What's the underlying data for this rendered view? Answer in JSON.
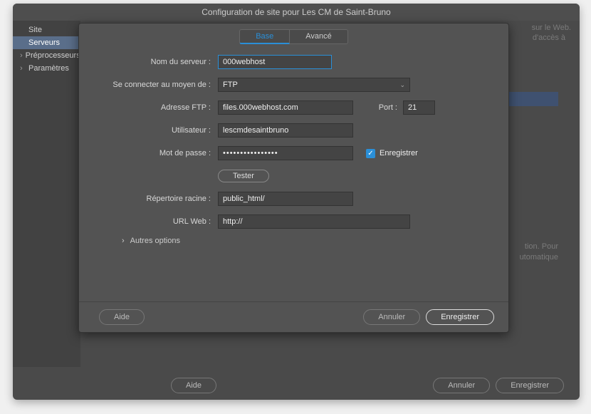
{
  "outer": {
    "title": "Configuration de site pour Les CM de Saint-Bruno",
    "sidebar": {
      "items": [
        {
          "label": "Site"
        },
        {
          "label": "Serveurs"
        },
        {
          "label": "Préprocesseurs"
        },
        {
          "label": "Paramètres"
        }
      ]
    },
    "bg_text1": "sur le Web.",
    "bg_text2": "d'accès à",
    "bg_status1": "tion. Pour",
    "bg_status2": "utomatique",
    "footer": {
      "help": "Aide",
      "cancel": "Annuler",
      "save": "Enregistrer"
    }
  },
  "inner": {
    "tabs": {
      "base": "Base",
      "advanced": "Avancé"
    },
    "labels": {
      "server_name": "Nom du serveur :",
      "connect_via": "Se connecter au moyen de :",
      "ftp_address": "Adresse FTP :",
      "port": "Port :",
      "user": "Utilisateur :",
      "password": "Mot de passe :",
      "save_cb": "Enregistrer",
      "test": "Tester",
      "root_dir": "Répertoire racine :",
      "web_url": "URL Web :",
      "other_options": "Autres options"
    },
    "values": {
      "server_name": "000webhost",
      "connect_via": "FTP",
      "ftp_address": "files.000webhost.com",
      "port": "21",
      "user": "lescmdesaintbruno",
      "password": "••••••••••••••••",
      "root_dir": "public_html/",
      "web_url": "http://"
    },
    "footer": {
      "help": "Aide",
      "cancel": "Annuler",
      "save": "Enregistrer"
    }
  }
}
